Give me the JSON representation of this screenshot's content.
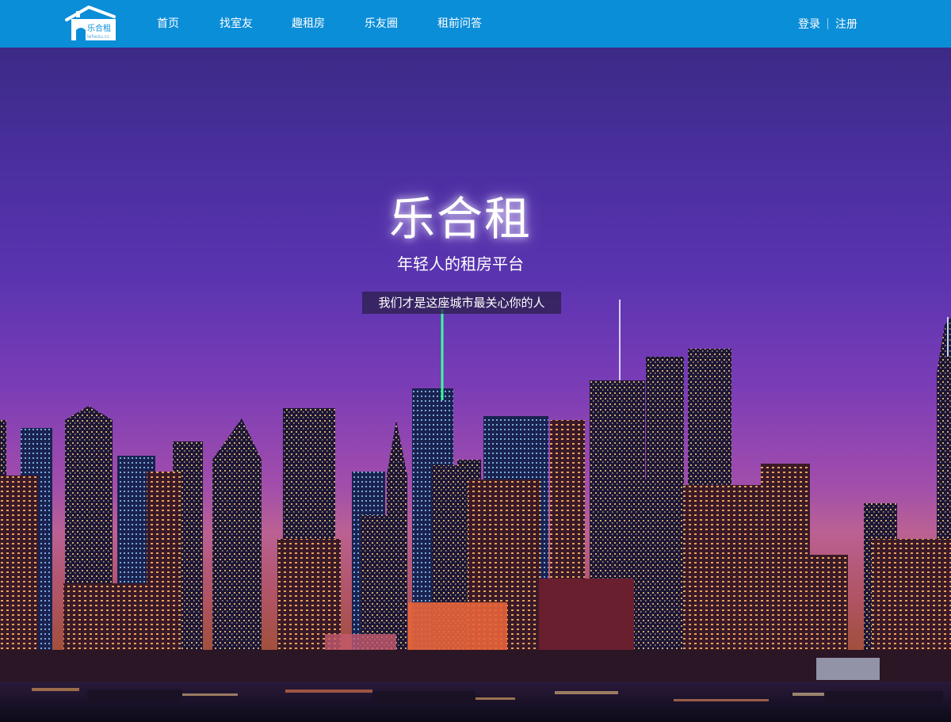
{
  "header": {
    "logo": {
      "name": "乐合租",
      "domain": "lehezu.cc"
    },
    "nav": [
      {
        "label": "首页"
      },
      {
        "label": "找室友"
      },
      {
        "label": "趣租房"
      },
      {
        "label": "乐友圈"
      },
      {
        "label": "租前问答"
      }
    ],
    "auth": {
      "login": "登录",
      "register": "注册"
    }
  },
  "hero": {
    "brand": "乐合租",
    "slogan": "年轻人的租房平台",
    "tagline": "我们才是这座城市最关心你的人"
  },
  "colors": {
    "header_bg": "#0b8ed8",
    "sky_top": "#3c2a86",
    "sky_mid": "#7a3cb6",
    "horizon": "#b25aa0"
  }
}
